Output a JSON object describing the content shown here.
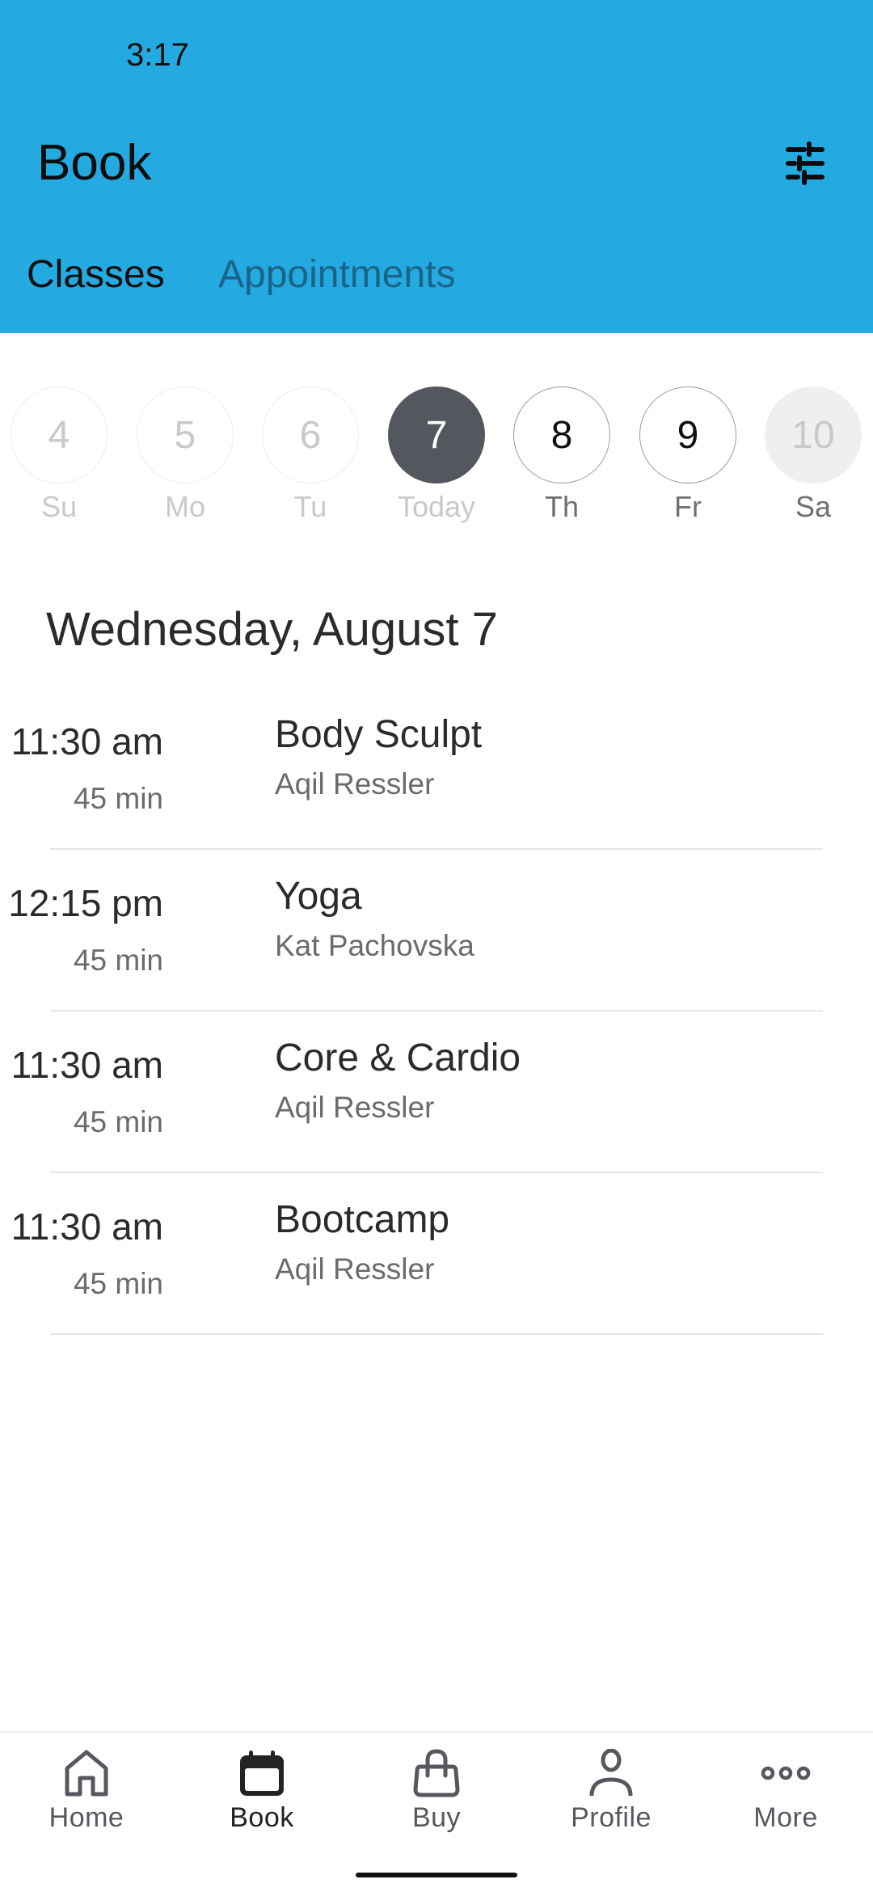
{
  "status_bar": {
    "time": "3:17"
  },
  "header": {
    "title": "Book",
    "filter_icon": "sliders-icon",
    "background_color": "#24A9E1"
  },
  "tabs": [
    {
      "label": "Classes",
      "active": true
    },
    {
      "label": "Appointments",
      "active": false
    }
  ],
  "week": {
    "days": [
      {
        "number": "4",
        "label": "Su",
        "state": "past"
      },
      {
        "number": "5",
        "label": "Mo",
        "state": "past"
      },
      {
        "number": "6",
        "label": "Tu",
        "state": "past"
      },
      {
        "number": "7",
        "label": "Today",
        "state": "today"
      },
      {
        "number": "8",
        "label": "Th",
        "state": "future"
      },
      {
        "number": "9",
        "label": "Fr",
        "state": "future"
      },
      {
        "number": "10",
        "label": "Sa",
        "state": "disabled"
      }
    ]
  },
  "schedule": {
    "date_heading": "Wednesday, August 7",
    "classes": [
      {
        "time": "11:30 am",
        "duration": "45 min",
        "name": "Body Sculpt",
        "instructor": "Aqil Ressler"
      },
      {
        "time": "12:15 pm",
        "duration": "45 min",
        "name": "Yoga",
        "instructor": "Kat Pachovska"
      },
      {
        "time": "11:30 am",
        "duration": "45 min",
        "name": "Core & Cardio",
        "instructor": "Aqil Ressler"
      },
      {
        "time": "11:30 am",
        "duration": "45 min",
        "name": "Bootcamp",
        "instructor": "Aqil Ressler"
      }
    ]
  },
  "bottom_nav": {
    "items": [
      {
        "label": "Home",
        "icon": "home-icon",
        "active": false
      },
      {
        "label": "Book",
        "icon": "calendar-icon",
        "active": true
      },
      {
        "label": "Buy",
        "icon": "shopping-bag-icon",
        "active": false
      },
      {
        "label": "Profile",
        "icon": "person-icon",
        "active": false
      },
      {
        "label": "More",
        "icon": "more-horizontal-icon",
        "active": false
      }
    ]
  }
}
